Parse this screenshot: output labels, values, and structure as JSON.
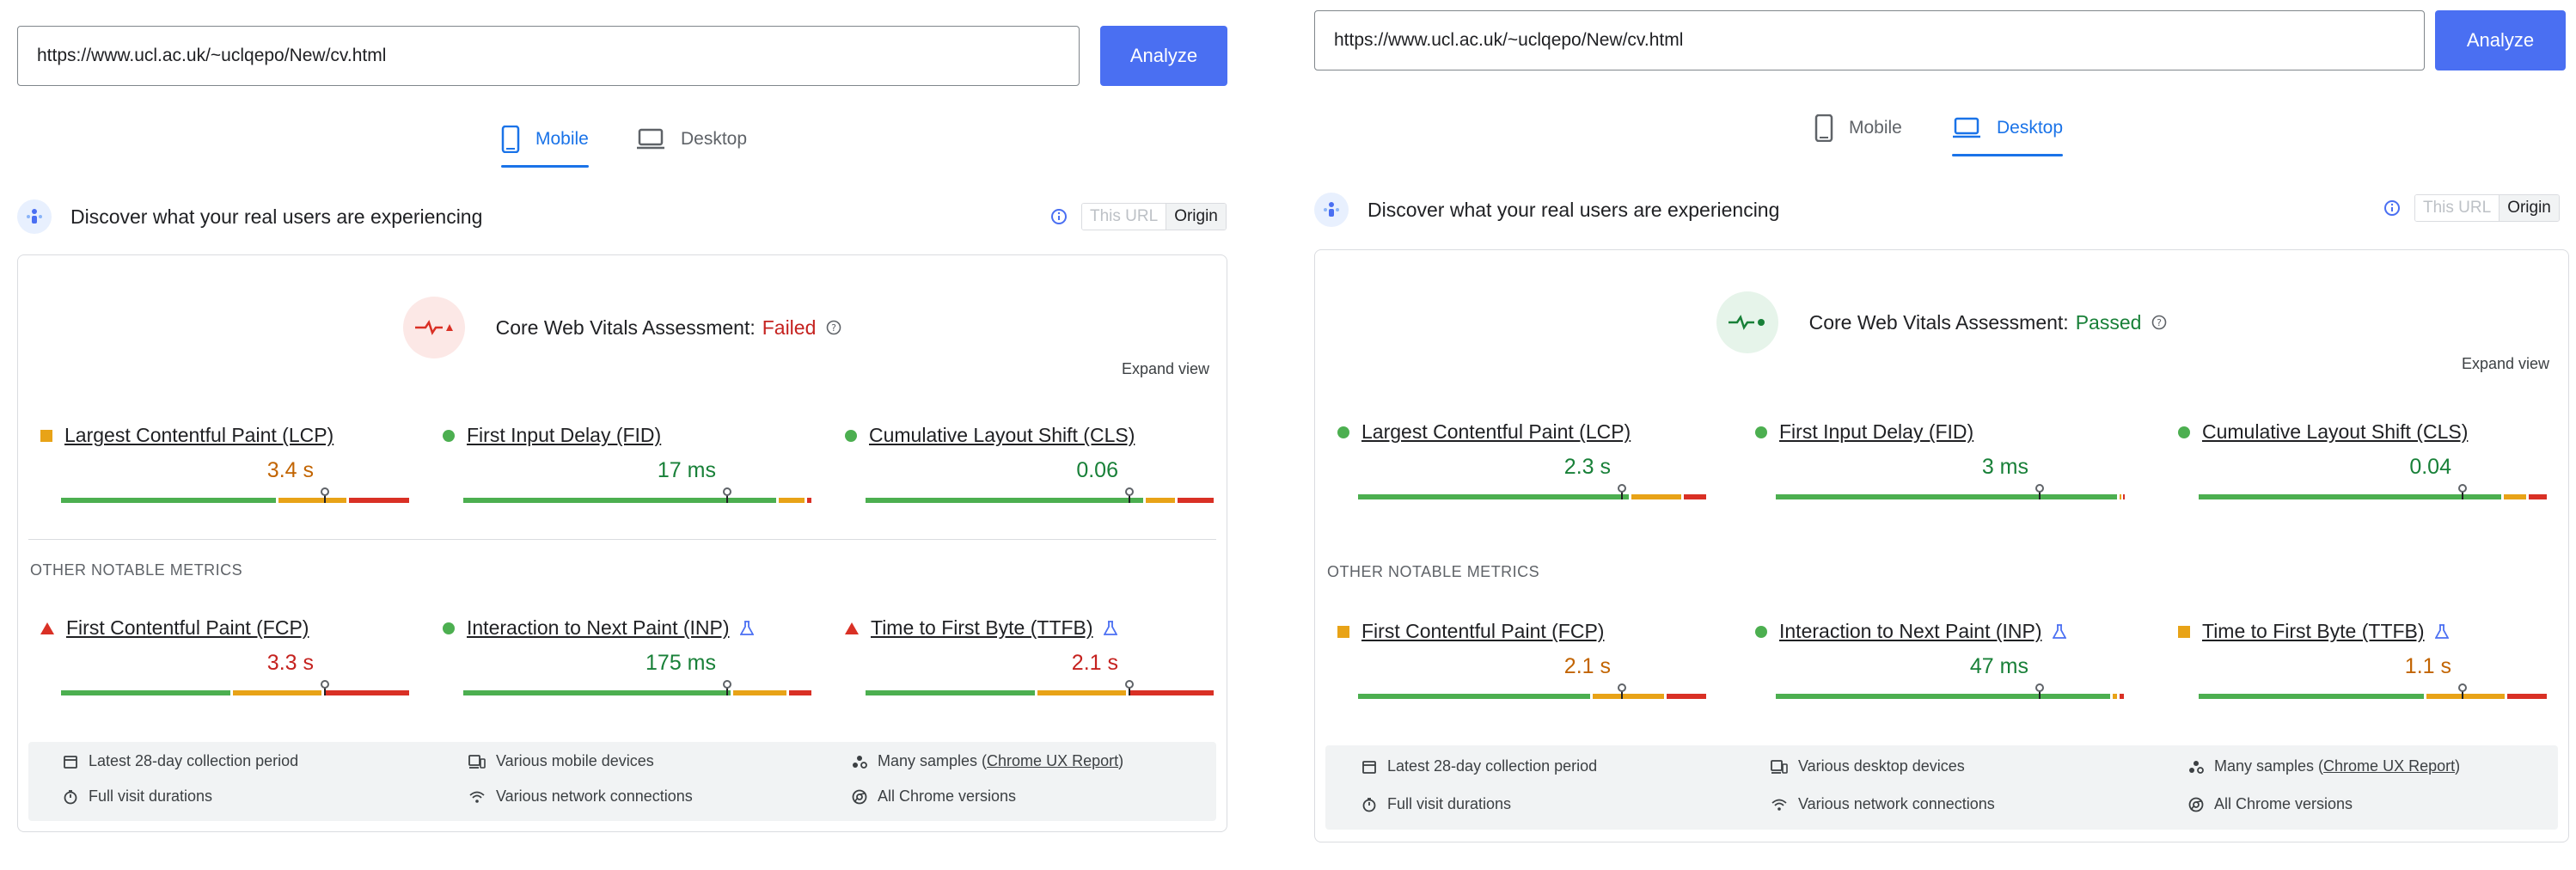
{
  "colors": {
    "accent": "#4a6ff2",
    "good": "#4caf50",
    "needs_improvement": "#e8a317",
    "poor": "#d93025"
  },
  "panels": [
    {
      "url": "https://www.ucl.ac.uk/~uclqepo/New/cv.html",
      "analyze_label": "Analyze",
      "tabs": {
        "mobile": "Mobile",
        "desktop": "Desktop",
        "active": "mobile"
      },
      "discover_text": "Discover what your real users are experiencing",
      "toggle": {
        "this_url": "This URL",
        "origin": "Origin"
      },
      "assessment": {
        "label": "Core Web Vitals Assessment:",
        "status": "Failed"
      },
      "expand_view": "Expand view",
      "core_metrics": [
        {
          "name": "Largest Contentful Paint (LCP)",
          "value": "3.4 s",
          "rating": "needs-improvement",
          "indicator": "square",
          "segments": [
            0.62,
            0.2,
            0.18
          ],
          "marker": 0.75
        },
        {
          "name": "First Input Delay (FID)",
          "value": "17 ms",
          "rating": "good",
          "indicator": "circle",
          "segments": [
            0.9,
            0.08,
            0.02
          ],
          "marker": 0.75
        },
        {
          "name": "Cumulative Layout Shift (CLS)",
          "value": "0.06",
          "rating": "good",
          "indicator": "circle",
          "segments": [
            0.8,
            0.09,
            0.11
          ],
          "marker": 0.75
        }
      ],
      "other_metrics_label": "OTHER NOTABLE METRICS",
      "other_metrics": [
        {
          "name": "First Contentful Paint (FCP)",
          "value": "3.3 s",
          "rating": "poor",
          "indicator": "triangle",
          "experimental": false,
          "segments": [
            0.49,
            0.26,
            0.25
          ],
          "marker": 0.75
        },
        {
          "name": "Interaction to Next Paint (INP)",
          "value": "175 ms",
          "rating": "good",
          "indicator": "circle",
          "experimental": true,
          "segments": [
            0.77,
            0.16,
            0.07
          ],
          "marker": 0.75
        },
        {
          "name": "Time to First Byte (TTFB)",
          "value": "2.1 s",
          "rating": "poor",
          "indicator": "triangle",
          "experimental": true,
          "segments": [
            0.49,
            0.26,
            0.25
          ],
          "marker": 0.75
        }
      ],
      "footer": {
        "period": "Latest 28-day collection period",
        "durations": "Full visit durations",
        "devices": "Various mobile devices",
        "network": "Various network connections",
        "samples_prefix": "Many samples (",
        "samples_link": "Chrome UX Report",
        "samples_suffix": ")",
        "versions": "All Chrome versions"
      }
    },
    {
      "url": "https://www.ucl.ac.uk/~uclqepo/New/cv.html",
      "analyze_label": "Analyze",
      "tabs": {
        "mobile": "Mobile",
        "desktop": "Desktop",
        "active": "desktop"
      },
      "discover_text": "Discover what your real users are experiencing",
      "toggle": {
        "this_url": "This URL",
        "origin": "Origin"
      },
      "assessment": {
        "label": "Core Web Vitals Assessment:",
        "status": "Passed"
      },
      "expand_view": "Expand view",
      "core_metrics": [
        {
          "name": "Largest Contentful Paint (LCP)",
          "value": "2.3 s",
          "rating": "good",
          "indicator": "circle",
          "segments": [
            0.78,
            0.15,
            0.07
          ],
          "marker": 0.75
        },
        {
          "name": "First Input Delay (FID)",
          "value": "3 ms",
          "rating": "good",
          "indicator": "circle",
          "segments": [
            0.98,
            0.01,
            0.01
          ],
          "marker": 0.75
        },
        {
          "name": "Cumulative Layout Shift (CLS)",
          "value": "0.04",
          "rating": "good",
          "indicator": "circle",
          "segments": [
            0.87,
            0.07,
            0.06
          ],
          "marker": 0.75
        }
      ],
      "other_metrics_label": "OTHER NOTABLE METRICS",
      "other_metrics": [
        {
          "name": "First Contentful Paint (FCP)",
          "value": "2.1 s",
          "rating": "needs-improvement",
          "indicator": "square",
          "experimental": false,
          "segments": [
            0.67,
            0.21,
            0.12
          ],
          "marker": 0.75
        },
        {
          "name": "Interaction to Next Paint (INP)",
          "value": "47 ms",
          "rating": "good",
          "indicator": "circle",
          "experimental": true,
          "segments": [
            0.96,
            0.02,
            0.02
          ],
          "marker": 0.75
        },
        {
          "name": "Time to First Byte (TTFB)",
          "value": "1.1 s",
          "rating": "needs-improvement",
          "indicator": "square",
          "experimental": true,
          "segments": [
            0.65,
            0.23,
            0.12
          ],
          "marker": 0.75
        }
      ],
      "footer": {
        "period": "Latest 28-day collection period",
        "durations": "Full visit durations",
        "devices": "Various desktop devices",
        "network": "Various network connections",
        "samples_prefix": "Many samples (",
        "samples_link": "Chrome UX Report",
        "samples_suffix": ")",
        "versions": "All Chrome versions"
      }
    }
  ]
}
